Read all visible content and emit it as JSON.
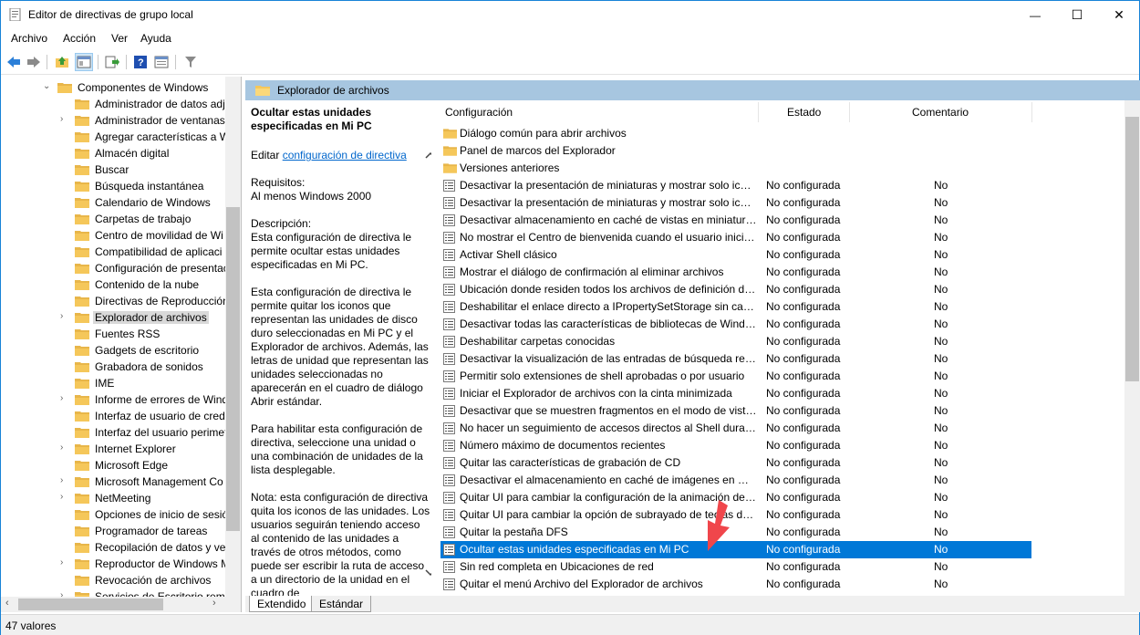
{
  "window": {
    "title": "Editor de directivas de grupo local",
    "minimize": "—",
    "maximize": "☐",
    "close": "✕"
  },
  "menu": [
    "Archivo",
    "Acción",
    "Ver",
    "Ayuda"
  ],
  "tree": {
    "items": [
      {
        "label": "Componentes de Windows",
        "level": 0,
        "expanded": true
      },
      {
        "label": "Administrador de datos adj",
        "level": 1,
        "arrow": false
      },
      {
        "label": "Administrador de ventanas",
        "level": 1,
        "arrow": true
      },
      {
        "label": "Agregar características a W",
        "level": 1,
        "arrow": false
      },
      {
        "label": "Almacén digital",
        "level": 1,
        "arrow": false
      },
      {
        "label": "Buscar",
        "level": 1,
        "arrow": false
      },
      {
        "label": "Búsqueda instantánea",
        "level": 1,
        "arrow": false
      },
      {
        "label": "Calendario de Windows",
        "level": 1,
        "arrow": false
      },
      {
        "label": "Carpetas de trabajo",
        "level": 1,
        "arrow": false
      },
      {
        "label": "Centro de movilidad de Wi",
        "level": 1,
        "arrow": false
      },
      {
        "label": "Compatibilidad de aplicaci",
        "level": 1,
        "arrow": false
      },
      {
        "label": "Configuración de presentac",
        "level": 1,
        "arrow": false
      },
      {
        "label": "Contenido de la nube",
        "level": 1,
        "arrow": false
      },
      {
        "label": "Directivas de Reproducción",
        "level": 1,
        "arrow": false
      },
      {
        "label": "Explorador de archivos",
        "level": 1,
        "arrow": true,
        "selected": true
      },
      {
        "label": "Fuentes RSS",
        "level": 1,
        "arrow": false
      },
      {
        "label": "Gadgets de escritorio",
        "level": 1,
        "arrow": false
      },
      {
        "label": "Grabadora de sonidos",
        "level": 1,
        "arrow": false
      },
      {
        "label": "IME",
        "level": 1,
        "arrow": false
      },
      {
        "label": "Informe de errores de Wind",
        "level": 1,
        "arrow": true
      },
      {
        "label": "Interfaz de usuario de crede",
        "level": 1,
        "arrow": false
      },
      {
        "label": "Interfaz del usuario perimet",
        "level": 1,
        "arrow": false
      },
      {
        "label": "Internet Explorer",
        "level": 1,
        "arrow": true
      },
      {
        "label": "Microsoft Edge",
        "level": 1,
        "arrow": false
      },
      {
        "label": "Microsoft Management Co",
        "level": 1,
        "arrow": true
      },
      {
        "label": "NetMeeting",
        "level": 1,
        "arrow": true
      },
      {
        "label": "Opciones de inicio de sesió",
        "level": 1,
        "arrow": false
      },
      {
        "label": "Programador de tareas",
        "level": 1,
        "arrow": false
      },
      {
        "label": "Recopilación de datos y ver",
        "level": 1,
        "arrow": false
      },
      {
        "label": "Reproductor de Windows M",
        "level": 1,
        "arrow": true
      },
      {
        "label": "Revocación de archivos",
        "level": 1,
        "arrow": false
      },
      {
        "label": "Servicios de Escritorio remo",
        "level": 1,
        "arrow": true
      }
    ]
  },
  "right_header": "Explorador de archivos",
  "description": {
    "title": "Ocultar estas unidades especificadas en Mi PC",
    "edit_prefix": "Editar ",
    "edit_link": "configuración de directiva",
    "requirements_label": "Requisitos:",
    "requirements_value": "Al menos Windows 2000",
    "description_label": "Descripción:",
    "p1": "Esta configuración de directiva le permite ocultar estas unidades especificadas en Mi PC.",
    "p2": "Esta configuración de directiva le permite quitar los iconos que representan las unidades de disco duro seleccionadas en Mi PC y el Explorador de archivos. Además, las letras de unidad que representan las unidades seleccionadas no aparecerán en el cuadro de diálogo Abrir estándar.",
    "p3": "Para habilitar esta configuración de directiva, seleccione una unidad o una combinación de unidades de la lista desplegable.",
    "p4": "Nota: esta configuración de directiva quita los iconos de las unidades. Los usuarios seguirán teniendo acceso al contenido de las unidades a través de otros métodos, como puede ser escribir la ruta de acceso a un directorio de la unidad en el cuadro de"
  },
  "columns": {
    "config": "Configuración",
    "state": "Estado",
    "comment": "Comentario"
  },
  "rows": [
    {
      "name": "Diálogo común para abrir archivos",
      "type": "folder",
      "state": "",
      "comment": ""
    },
    {
      "name": "Panel de marcos del Explorador",
      "type": "folder",
      "state": "",
      "comment": ""
    },
    {
      "name": "Versiones anteriores",
      "type": "folder",
      "state": "",
      "comment": ""
    },
    {
      "name": "Desactivar la presentación de miniaturas y mostrar solo icon...",
      "type": "setting",
      "state": "No configurada",
      "comment": "No"
    },
    {
      "name": "Desactivar la presentación de miniaturas y mostrar solo icon...",
      "type": "setting",
      "state": "No configurada",
      "comment": "No"
    },
    {
      "name": "Desactivar almacenamiento en caché de vistas en miniatura ...",
      "type": "setting",
      "state": "No configurada",
      "comment": "No"
    },
    {
      "name": "No mostrar el Centro de bienvenida cuando el usuario inicie...",
      "type": "setting",
      "state": "No configurada",
      "comment": "No"
    },
    {
      "name": "Activar Shell clásico",
      "type": "setting",
      "state": "No configurada",
      "comment": "No"
    },
    {
      "name": "Mostrar el diálogo de confirmación al eliminar archivos",
      "type": "setting",
      "state": "No configurada",
      "comment": "No"
    },
    {
      "name": "Ubicación donde residen todos los archivos de definición de...",
      "type": "setting",
      "state": "No configurada",
      "comment": "No"
    },
    {
      "name": "Deshabilitar el enlace directo a IPropertySetStorage sin capa...",
      "type": "setting",
      "state": "No configurada",
      "comment": "No"
    },
    {
      "name": "Desactivar todas las características de bibliotecas de Windo...",
      "type": "setting",
      "state": "No configurada",
      "comment": "No"
    },
    {
      "name": "Deshabilitar carpetas conocidas",
      "type": "setting",
      "state": "No configurada",
      "comment": "No"
    },
    {
      "name": "Desactivar la visualización de las entradas de búsqueda recie...",
      "type": "setting",
      "state": "No configurada",
      "comment": "No"
    },
    {
      "name": "Permitir solo extensiones de shell aprobadas o por usuario",
      "type": "setting",
      "state": "No configurada",
      "comment": "No"
    },
    {
      "name": "Iniciar el Explorador de archivos con la cinta minimizada",
      "type": "setting",
      "state": "No configurada",
      "comment": "No"
    },
    {
      "name": "Desactivar que se muestren fragmentos en el modo de vista ...",
      "type": "setting",
      "state": "No configurada",
      "comment": "No"
    },
    {
      "name": "No hacer un seguimiento de accesos directos al Shell durant...",
      "type": "setting",
      "state": "No configurada",
      "comment": "No"
    },
    {
      "name": "Número máximo de documentos recientes",
      "type": "setting",
      "state": "No configurada",
      "comment": "No"
    },
    {
      "name": "Quitar las características de grabación de CD",
      "type": "setting",
      "state": "No configurada",
      "comment": "No"
    },
    {
      "name": "Desactivar el almacenamiento en caché de imágenes en mi...",
      "type": "setting",
      "state": "No configurada",
      "comment": "No"
    },
    {
      "name": "Quitar UI para cambiar la configuración de la animación de ...",
      "type": "setting",
      "state": "No configurada",
      "comment": "No"
    },
    {
      "name": "Quitar UI para cambiar la opción de subrayado de teclas de ...",
      "type": "setting",
      "state": "No configurada",
      "comment": "No"
    },
    {
      "name": "Quitar la pestaña DFS",
      "type": "setting",
      "state": "No configurada",
      "comment": "No"
    },
    {
      "name": "Ocultar estas unidades especificadas en Mi PC",
      "type": "setting",
      "state": "No configurada",
      "comment": "No",
      "selected": true
    },
    {
      "name": "Sin red completa en Ubicaciones de red",
      "type": "setting",
      "state": "No configurada",
      "comment": "No"
    },
    {
      "name": "Quitar el menú Archivo del Explorador de archivos",
      "type": "setting",
      "state": "No configurada",
      "comment": "No"
    }
  ],
  "tabs": [
    "Extendido",
    "Estándar"
  ],
  "status": "47 valores",
  "colors": {
    "accent": "#0078d7",
    "header_band": "#a7c6e0",
    "folder": "#f5c75a",
    "arrow_annotation": "#f0464b"
  }
}
